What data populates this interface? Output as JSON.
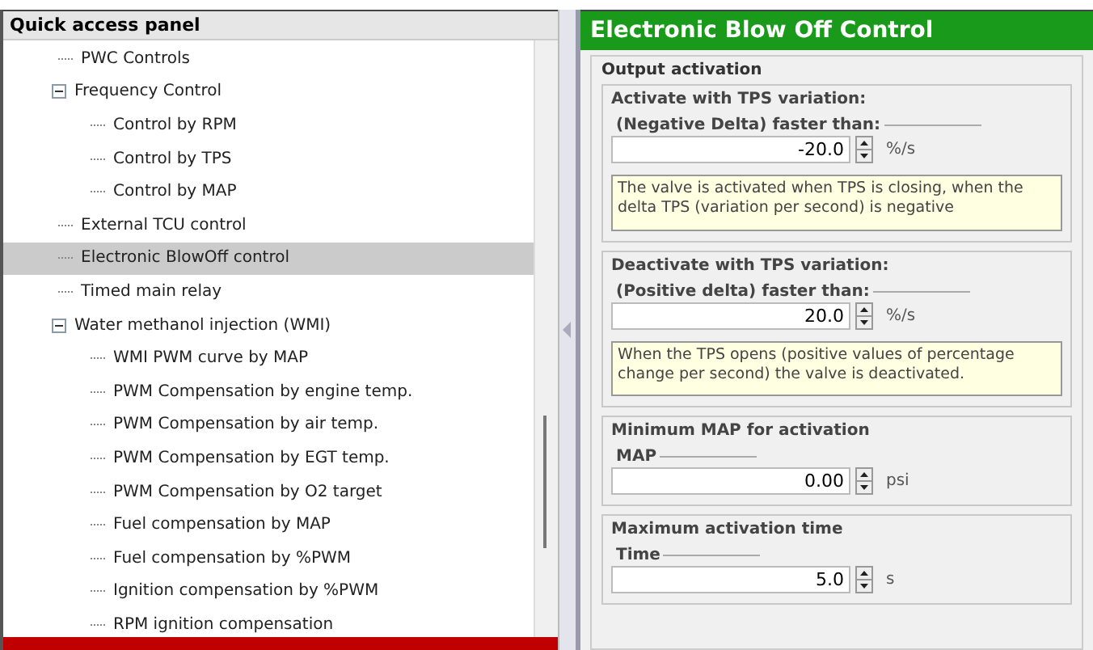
{
  "quick_panel": {
    "title": "Quick access panel",
    "tree": [
      {
        "label": "PWC Controls",
        "selected": false
      },
      {
        "label": "Frequency Control",
        "selected": false,
        "expanded": true,
        "children": [
          {
            "label": "Control by RPM",
            "selected": false
          },
          {
            "label": "Control by TPS",
            "selected": false
          },
          {
            "label": "Control by MAP",
            "selected": false
          }
        ]
      },
      {
        "label": "External TCU control",
        "selected": false
      },
      {
        "label": "Electronic BlowOff control",
        "selected": true
      },
      {
        "label": "Timed main relay",
        "selected": false
      },
      {
        "label": "Water methanol injection (WMI)",
        "selected": false,
        "expanded": true,
        "children": [
          {
            "label": "WMI PWM curve by MAP",
            "selected": false
          },
          {
            "label": "PWM Compensation by engine temp.",
            "selected": false
          },
          {
            "label": "PWM Compensation by air temp.",
            "selected": false
          },
          {
            "label": "PWM Compensation by EGT temp.",
            "selected": false
          },
          {
            "label": "PWM Compensation by O2 target",
            "selected": false
          },
          {
            "label": "Fuel compensation by MAP",
            "selected": false
          },
          {
            "label": "Fuel compensation by %PWM",
            "selected": false
          },
          {
            "label": "Ignition compensation by %PWM",
            "selected": false
          },
          {
            "label": "RPM ignition compensation",
            "selected": false
          }
        ]
      }
    ]
  },
  "form": {
    "title": "Electronic Blow Off Control",
    "group_title": "Output activation",
    "sections": [
      {
        "title": "Activate with TPS variation:",
        "field_label": "(Negative Delta) faster than:",
        "value": "-20.0",
        "unit": "%/s",
        "note": "The valve is activated when TPS is closing, when the delta TPS (variation per second) is negative"
      },
      {
        "title": "Deactivate with TPS variation:",
        "field_label": "(Positive delta) faster than:",
        "value": "20.0",
        "unit": "%/s",
        "note": "When the TPS opens (positive values of percentage change per second) the valve is deactivated."
      },
      {
        "title": "Minimum MAP for activation",
        "field_label": "MAP",
        "value": "0.00",
        "unit": "psi"
      },
      {
        "title": "Maximum activation time",
        "field_label": "Time",
        "value": "5.0",
        "unit": "s"
      }
    ]
  }
}
